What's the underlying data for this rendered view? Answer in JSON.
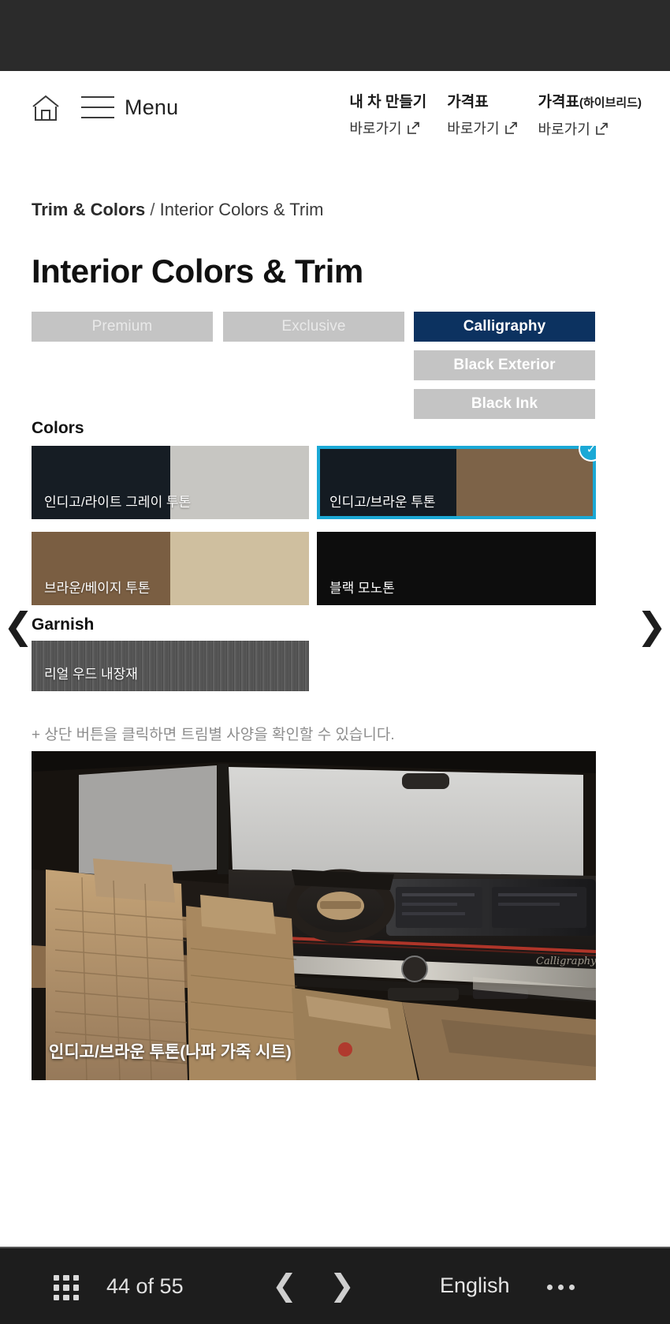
{
  "header": {
    "menu_label": "Menu",
    "home_icon": "home-icon",
    "hamburger_icon": "hamburger-icon",
    "quicklinks": [
      {
        "title": "내 차 만들기",
        "title_sub": "",
        "go_label": "바로가기",
        "icon": "external-link-icon"
      },
      {
        "title": "가격표",
        "title_sub": "",
        "go_label": "바로가기",
        "icon": "external-link-icon"
      },
      {
        "title": "가격표",
        "title_sub": "(하이브리드)",
        "go_label": "바로가기",
        "icon": "external-link-icon"
      }
    ]
  },
  "breadcrumb": {
    "root": "Trim & Colors",
    "separator": "/",
    "current": "Interior Colors & Trim"
  },
  "page_title": "Interior Colors & Trim",
  "trims": [
    {
      "label": "Premium",
      "state": "inactive"
    },
    {
      "label": "Exclusive",
      "state": "inactive"
    },
    {
      "label": "Calligraphy",
      "state": "active"
    },
    {
      "label": "Black Exterior",
      "state": "inactive"
    },
    {
      "label": "Black Ink",
      "state": "inactive"
    }
  ],
  "sections": {
    "colors_title": "Colors",
    "garnish_title": "Garnish"
  },
  "colors": [
    {
      "label": "인디고/라이트 그레이 투톤",
      "left_color": "#161d24",
      "right_color": "#c7c6c2",
      "selected": false
    },
    {
      "label": "인디고/브라운 투톤",
      "left_color": "#141b22",
      "right_color": "#7d6348",
      "selected": true
    },
    {
      "label": "브라운/베이지 투톤",
      "left_color": "#7a5e42",
      "right_color": "#cfbf9f",
      "selected": false
    },
    {
      "label": "블랙 모노톤",
      "left_color": "#0d0d0d",
      "right_color": "#0d0d0d",
      "selected": false
    }
  ],
  "garnish": [
    {
      "label": "리얼 우드 내장재"
    }
  ],
  "note": "+ 상단 버튼을 클릭하면 트림별 사양을 확인할 수 있습니다.",
  "hero": {
    "caption": "인디고/브라운 투톤(나파 가죽 시트)",
    "badge_text": "Calligraphy"
  },
  "carousel": {
    "prev_icon": "chevron-left-icon",
    "next_icon": "chevron-right-icon"
  },
  "bottombar": {
    "grid_icon": "grid-menu-icon",
    "page_count": "44 of 55",
    "prev_icon": "chevron-left-icon",
    "next_icon": "chevron-right-icon",
    "language": "English",
    "more_icon": "more-options-icon"
  },
  "accent_colors": {
    "active_trim_bg": "#0c3260",
    "inactive_trim_bg": "#c4c4c4",
    "selection_outline": "#1ba9d6",
    "bottombar_bg": "#1d1d1d",
    "statusbar_bg": "#2b2b2b"
  }
}
